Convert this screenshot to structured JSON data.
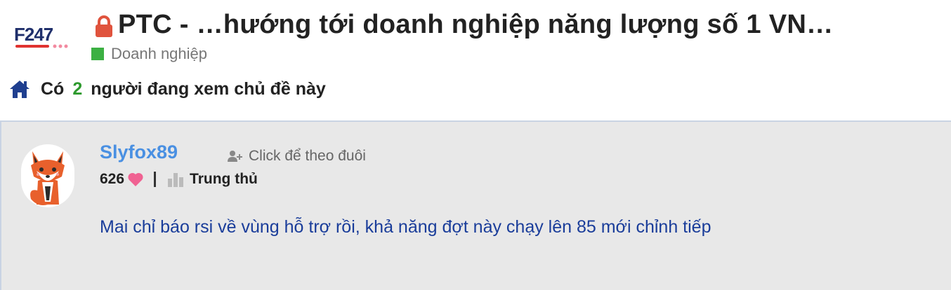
{
  "site": {
    "logo_text": "F247"
  },
  "thread": {
    "title": "PTC - …hướng tới doanh nghiệp năng lượng số 1 VN…",
    "category": "Doanh nghiệp",
    "category_color": "#3cb043",
    "locked": true
  },
  "viewers": {
    "prefix": "Có",
    "count": "2",
    "suffix": "người đang xem chủ đề này"
  },
  "post": {
    "username": "Slyfox89",
    "follow_label": "Click để theo đuôi",
    "likes": "626",
    "rank": "Trung thủ",
    "message": "Mai chỉ báo rsi về vùng hỗ trợ rồi, khả năng đợt này chạy lên 85 mới chỉnh tiếp"
  },
  "colors": {
    "username": "#4a90e2",
    "message": "#1a3d9a",
    "viewer_count": "#2e9a2e",
    "heart": "#f06292",
    "lock": "#e0533d"
  },
  "icons": [
    "f247-logo",
    "lock-icon",
    "home-icon",
    "fox-avatar",
    "add-user-icon",
    "heart-icon",
    "rank-icon"
  ]
}
